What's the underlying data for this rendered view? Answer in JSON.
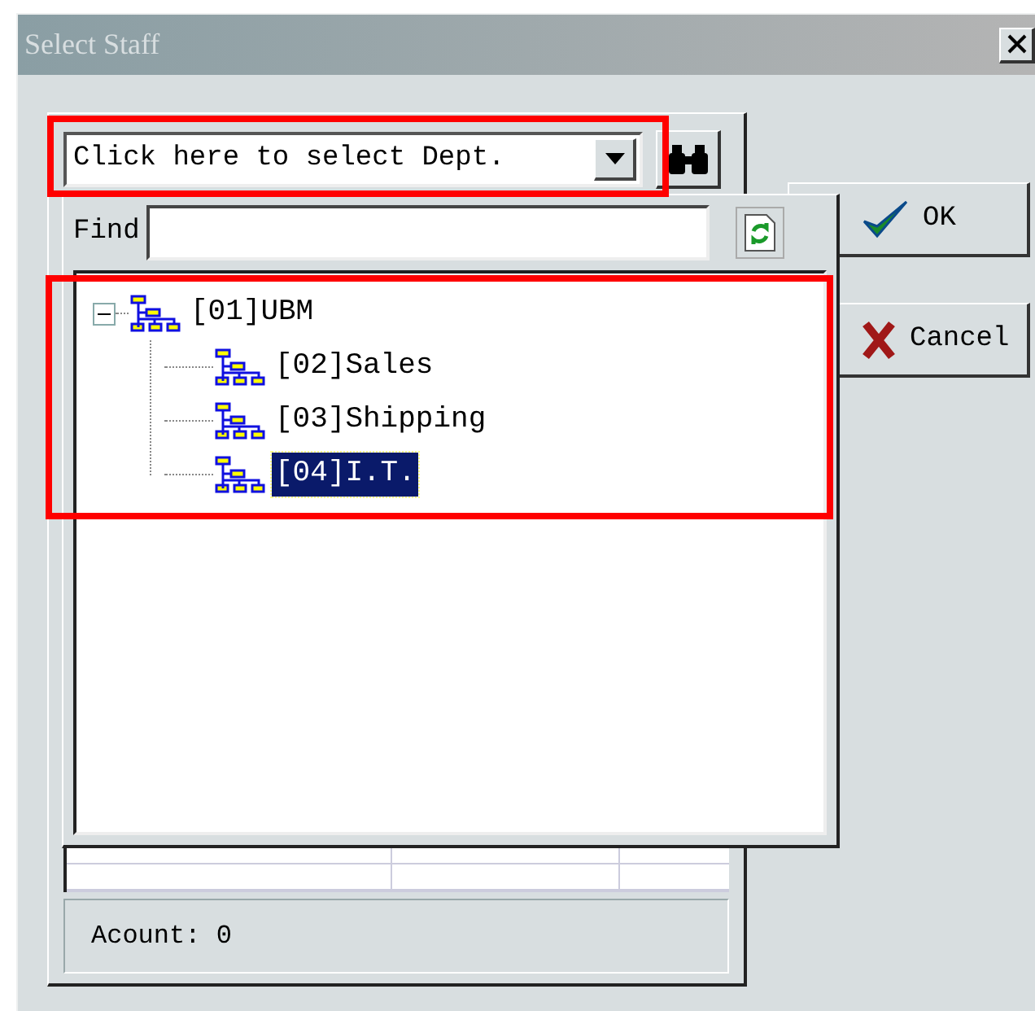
{
  "window": {
    "title": "Select Staff"
  },
  "department_select": {
    "value": "Click here to select Dept."
  },
  "buttons": [
    {
      "label": "OK",
      "kind": "ok"
    },
    {
      "label": "Cancel",
      "kind": "cancel"
    }
  ],
  "dropdown": {
    "find_label": "Find",
    "tree": [
      {
        "label": "[01]UBM",
        "expanded": true,
        "selected": false,
        "children": [
          {
            "label": "[02]Sales",
            "selected": false
          },
          {
            "label": "[03]Shipping",
            "selected": false
          },
          {
            "label": "[04]I.T.",
            "selected": true
          }
        ]
      }
    ]
  },
  "status_bar": {
    "text": "Acount: 0"
  }
}
